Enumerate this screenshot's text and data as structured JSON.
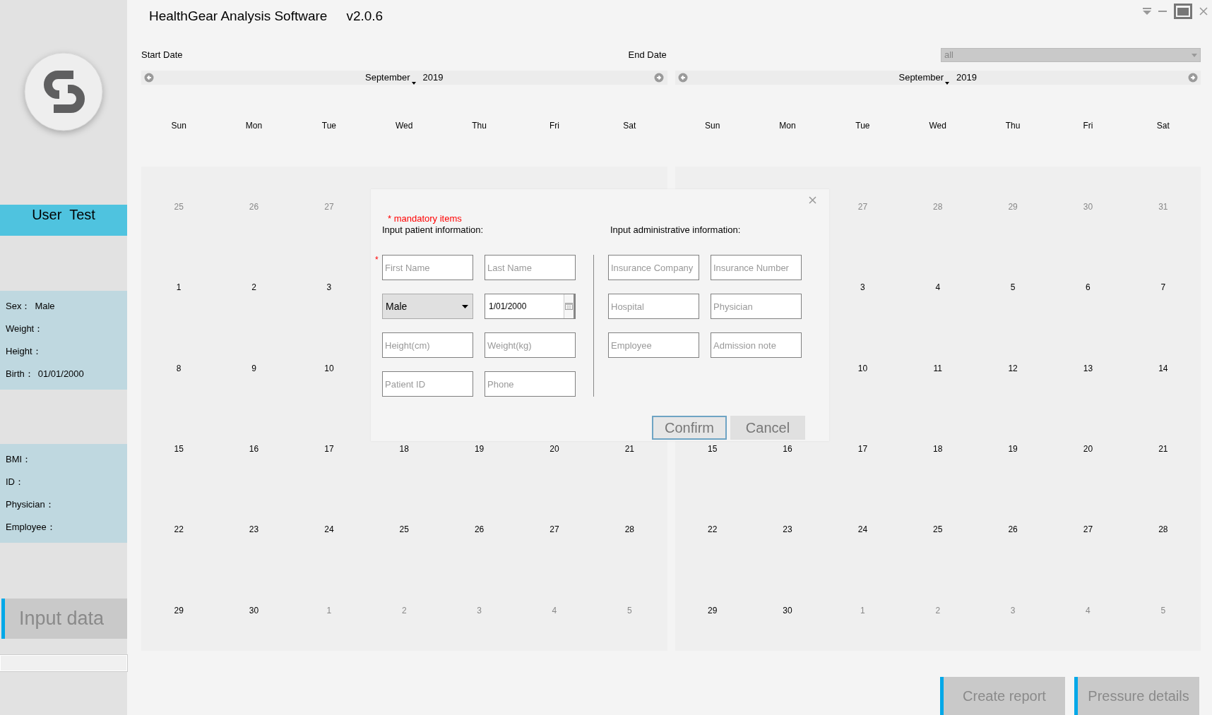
{
  "window": {
    "title": "HealthGear Analysis Software",
    "version": "v2.0.6"
  },
  "sidebar": {
    "user_name": "User  Test",
    "patient_info": [
      {
        "label": "Sex：",
        "value": "Male"
      },
      {
        "label": "Weight："
      },
      {
        "label": "Height："
      },
      {
        "label": "Birth：",
        "value": "01/01/2000"
      }
    ],
    "measure_info": [
      {
        "label": "BMI："
      },
      {
        "label": "ID："
      },
      {
        "label": "Physician："
      },
      {
        "label": "Employee："
      }
    ],
    "input_button": "Input data"
  },
  "start_date": {
    "label": "Start Date",
    "month": "September",
    "year": "2019",
    "weekdays": [
      "Sun",
      "Mon",
      "Tue",
      "Wed",
      "Thu",
      "Fri",
      "Sat"
    ],
    "weeks": [
      {
        "cells": [
          {
            "day": "25",
            "outside_month": true
          },
          {
            "day": "26",
            "outside_month": true
          },
          {
            "day": "27",
            "outside_month": true
          }
        ]
      },
      {
        "cells": [
          {
            "day": "1",
            "outside_month": false
          },
          {
            "day": "2",
            "outside_month": false
          },
          {
            "day": "3",
            "outside_month": false
          }
        ]
      },
      {
        "cells": [
          {
            "day": "8",
            "outside_month": false
          },
          {
            "day": "9",
            "outside_month": false
          },
          {
            "day": "10",
            "outside_month": false
          }
        ]
      },
      {
        "cells": [
          {
            "day": "15",
            "outside_month": false
          },
          {
            "day": "16",
            "outside_month": false
          },
          {
            "day": "17",
            "outside_month": false
          },
          {
            "day": "18",
            "outside_month": false
          },
          {
            "day": "19",
            "outside_month": false
          },
          {
            "day": "20",
            "outside_month": false
          },
          {
            "day": "21",
            "outside_month": false
          }
        ]
      },
      {
        "cells": [
          {
            "day": "22",
            "outside_month": false
          },
          {
            "day": "23",
            "outside_month": false
          },
          {
            "day": "24",
            "outside_month": false
          },
          {
            "day": "25",
            "outside_month": false
          },
          {
            "day": "26",
            "outside_month": false
          },
          {
            "day": "27",
            "outside_month": false
          },
          {
            "day": "28",
            "outside_month": false
          }
        ]
      },
      {
        "cells": [
          {
            "day": "29",
            "outside_month": false
          },
          {
            "day": "30",
            "outside_month": false
          },
          {
            "day": "1",
            "outside_month": true
          },
          {
            "day": "2",
            "outside_month": true
          },
          {
            "day": "3",
            "outside_month": true
          },
          {
            "day": "4",
            "outside_month": true
          },
          {
            "day": "5",
            "outside_month": true
          }
        ]
      }
    ]
  },
  "end_date": {
    "label": "End Date",
    "filter": "all",
    "month": "September",
    "year": "2019",
    "weekdays": [
      "Sun",
      "Mon",
      "Tue",
      "Wed",
      "Thu",
      "Fri",
      "Sat"
    ],
    "weeks": [
      {
        "kind": "tail",
        "cells": [
          {
            "day": "27",
            "outside_month": true
          },
          {
            "day": "28",
            "outside_month": true
          },
          {
            "day": "29",
            "outside_month": true
          },
          {
            "day": "30",
            "outside_month": true
          },
          {
            "day": "31",
            "outside_month": true
          }
        ]
      },
      {
        "kind": "tail",
        "cells": [
          {
            "day": "3",
            "outside_month": false
          },
          {
            "day": "4",
            "outside_month": false
          },
          {
            "day": "5",
            "outside_month": false
          },
          {
            "day": "6",
            "outside_month": false
          },
          {
            "day": "7",
            "outside_month": false
          }
        ]
      },
      {
        "kind": "tail",
        "cells": [
          {
            "day": "10",
            "outside_month": false
          },
          {
            "day": "11",
            "outside_month": false
          },
          {
            "day": "12",
            "outside_month": false
          },
          {
            "day": "13",
            "outside_month": false
          },
          {
            "day": "14",
            "outside_month": false
          }
        ]
      },
      {
        "cells": [
          {
            "day": "15",
            "outside_month": false
          },
          {
            "day": "16",
            "outside_month": false
          },
          {
            "day": "17",
            "outside_month": false
          },
          {
            "day": "18",
            "outside_month": false
          },
          {
            "day": "19",
            "outside_month": false
          },
          {
            "day": "20",
            "outside_month": false
          },
          {
            "day": "21",
            "outside_month": false
          }
        ]
      },
      {
        "cells": [
          {
            "day": "22",
            "outside_month": false
          },
          {
            "day": "23",
            "outside_month": false
          },
          {
            "day": "24",
            "outside_month": false
          },
          {
            "day": "25",
            "outside_month": false
          },
          {
            "day": "26",
            "outside_month": false
          },
          {
            "day": "27",
            "outside_month": false
          },
          {
            "day": "28",
            "outside_month": false
          }
        ]
      },
      {
        "cells": [
          {
            "day": "29",
            "outside_month": false
          },
          {
            "day": "30",
            "outside_month": false
          },
          {
            "day": "1",
            "outside_month": true
          },
          {
            "day": "2",
            "outside_month": true
          },
          {
            "day": "3",
            "outside_month": true
          },
          {
            "day": "4",
            "outside_month": true
          },
          {
            "day": "5",
            "outside_month": true
          }
        ]
      }
    ]
  },
  "dialog": {
    "mandatory_note": "* mandatory items",
    "patient_heading": "Input patient information:",
    "admin_heading": "Input administrative information:",
    "patient_fields": [
      {
        "kind": "text",
        "placeholder": "First Name",
        "required_mark": "*"
      },
      {
        "kind": "text",
        "placeholder": "Last Name"
      },
      {
        "kind": "select",
        "value": "Male"
      },
      {
        "kind": "date",
        "value": "1/01/2000"
      },
      {
        "kind": "text",
        "placeholder": "Height(cm)"
      },
      {
        "kind": "text",
        "placeholder": "Weight(kg)"
      },
      {
        "kind": "text",
        "placeholder": "Patient ID"
      },
      {
        "kind": "text",
        "placeholder": "Phone"
      }
    ],
    "admin_fields": [
      {
        "kind": "text",
        "placeholder": "Insurance Company"
      },
      {
        "kind": "text",
        "placeholder": "Insurance Number"
      },
      {
        "kind": "text",
        "placeholder": "Hospital"
      },
      {
        "kind": "text",
        "placeholder": "Physician"
      },
      {
        "kind": "text",
        "placeholder": "Employee"
      },
      {
        "kind": "text",
        "placeholder": "Admission note"
      }
    ],
    "buttons": [
      {
        "label": "Confirm",
        "focused": true
      },
      {
        "label": "Cancel",
        "focused": false
      }
    ]
  },
  "footer_buttons": [
    "Create report",
    "Pressure details"
  ]
}
